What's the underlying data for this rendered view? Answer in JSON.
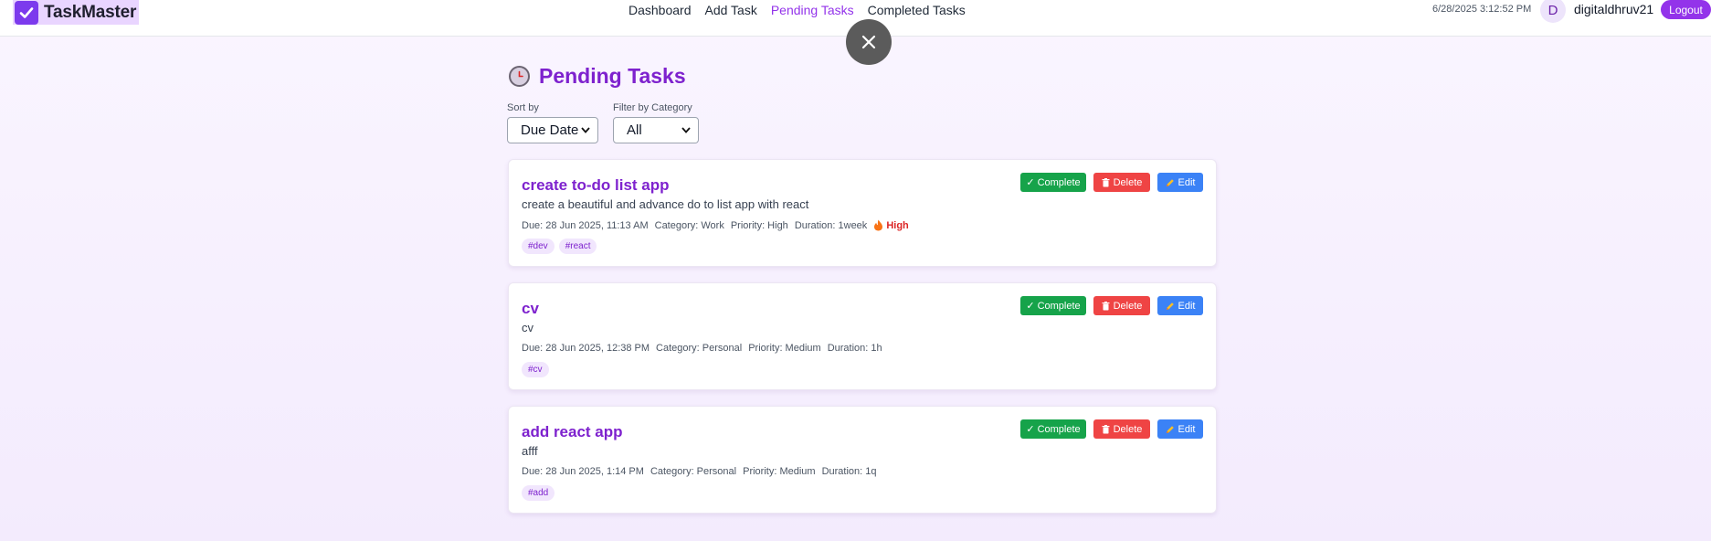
{
  "app": {
    "name": "TaskMaster",
    "logo_icon": "check-icon"
  },
  "nav": [
    "Dashboard",
    "Add Task",
    "Pending Tasks",
    "Completed Tasks"
  ],
  "nav_active": "Pending Tasks",
  "header": {
    "datetime": "6/28/2025 3:12:52 PM",
    "avatar_initial": "D",
    "username": "digitaldhruv21",
    "logout_label": "Logout"
  },
  "overlay": {
    "close_glyph": "✕"
  },
  "page": {
    "title": "Pending Tasks",
    "title_icon": "clock-icon",
    "sort_label": "Sort by",
    "sort_value": "Due Date",
    "filter_label": "Filter by Category",
    "filter_value": "All"
  },
  "buttons": {
    "complete": "✓ Complete",
    "delete": "Delete",
    "edit": "Edit"
  },
  "tasks": [
    {
      "title": "create to-do list app",
      "description": "create a beautiful and advance do to list app with react",
      "due": "Due: 28 Jun 2025, 11:13 AM",
      "category": "Category: Work",
      "priority": "Priority: High",
      "duration": "Duration: 1week",
      "flag": "High",
      "tags": [
        "#dev",
        "#react"
      ]
    },
    {
      "title": "cv",
      "description": "cv",
      "due": "Due: 28 Jun 2025, 12:38 PM",
      "category": "Category: Personal",
      "priority": "Priority: Medium",
      "duration": "Duration: 1h",
      "flag": "",
      "tags": [
        "#cv"
      ]
    },
    {
      "title": "add react app",
      "description": "afff",
      "due": "Due: 28 Jun 2025, 1:14 PM",
      "category": "Category: Personal",
      "priority": "Priority: Medium",
      "duration": "Duration: 1q",
      "flag": "",
      "tags": [
        "#add"
      ]
    }
  ],
  "colors": {
    "accent": "#9333ea",
    "complete": "#16a34a",
    "delete": "#ef4444",
    "edit": "#3b82f6"
  }
}
